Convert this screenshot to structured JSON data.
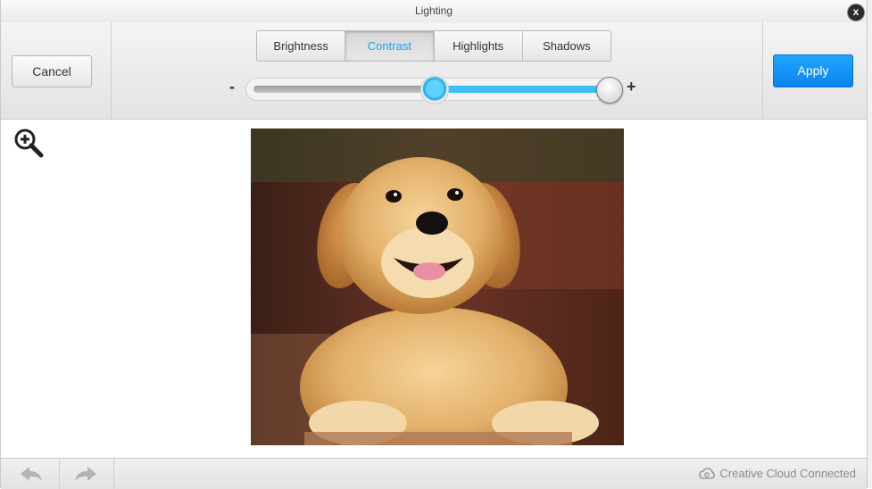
{
  "dialog": {
    "title": "Lighting",
    "close_label": "x"
  },
  "toolbar": {
    "cancel_label": "Cancel",
    "apply_label": "Apply",
    "tabs": [
      {
        "label": "Brightness",
        "active": false
      },
      {
        "label": "Contrast",
        "active": true
      },
      {
        "label": "Highlights",
        "active": false
      },
      {
        "label": "Shadows",
        "active": false
      }
    ],
    "slider": {
      "minus_label": "-",
      "plus_label": "+",
      "value_fraction": 1.0
    }
  },
  "canvas": {
    "zoom_icon": "zoom-in-icon",
    "image_subject": "golden retriever puppy"
  },
  "footer": {
    "undo_icon": "undo-icon",
    "redo_icon": "redo-icon",
    "status_text": "Creative Cloud Connected"
  },
  "colors": {
    "accent": "#1ea0f0",
    "apply_button": "#0b84f0",
    "slider_fill": "#3bc0f5"
  }
}
